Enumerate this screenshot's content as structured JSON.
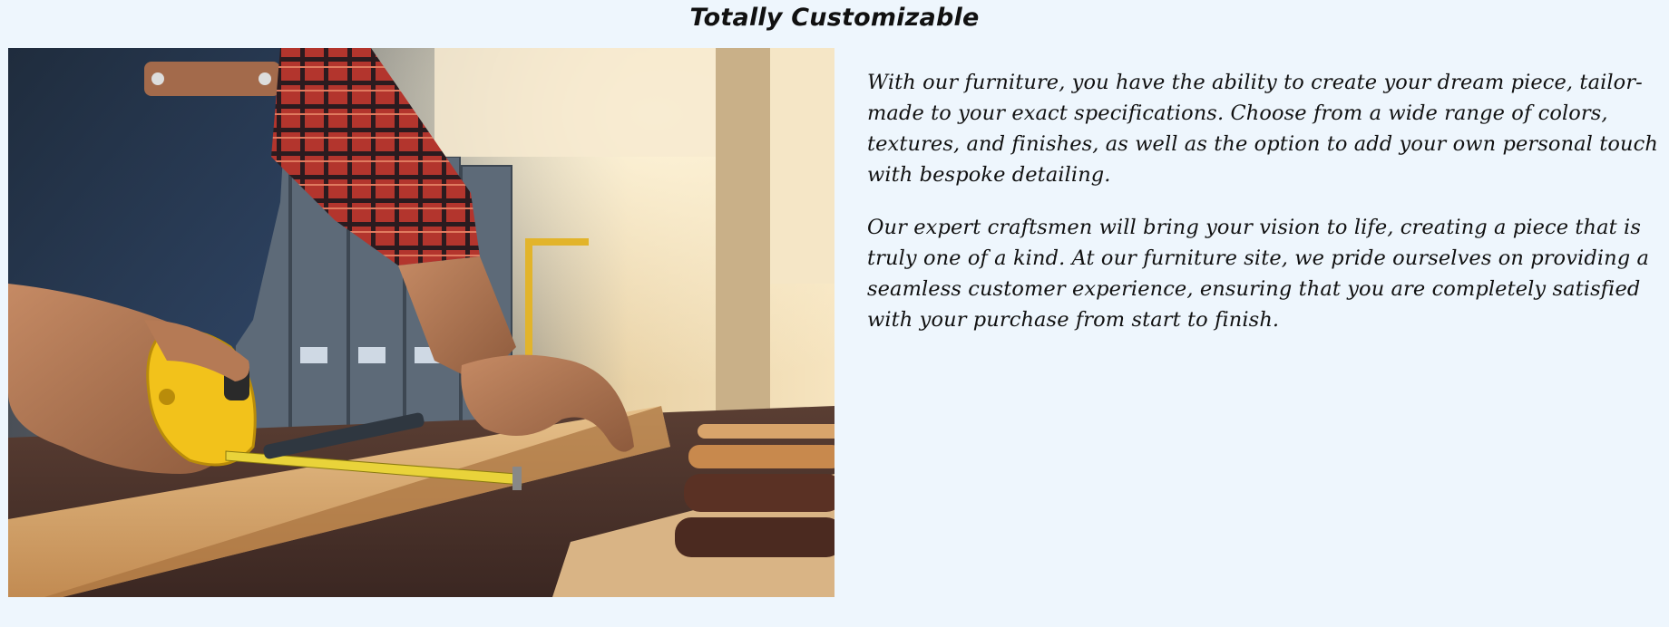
{
  "section": {
    "title": "Totally Customizable",
    "image_alt": "Craftsman measuring a wooden plank with a yellow tape measure in a workshop",
    "paragraphs": [
      "With our furniture, you have the ability to create your dream piece, tailor-made to your exact specifications. Choose from a wide range of colors, textures, and finishes, as well as the option to add your own personal touch with bespoke detailing.",
      "Our expert craftsmen will bring your vision to life, creating a piece that is truly one of a kind. At our furniture site, we pride ourselves on providing a seamless customer experience, ensuring that you are completely satisfied with your purchase from start to finish."
    ]
  },
  "colors": {
    "background": "#eef6fd",
    "text": "#111111",
    "tape_yellow": "#f2c21b"
  }
}
